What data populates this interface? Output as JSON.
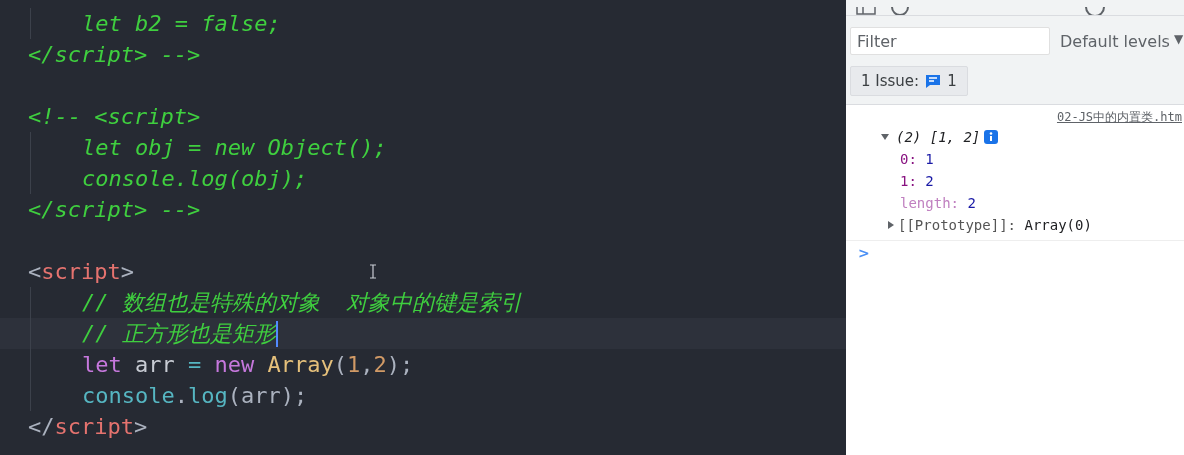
{
  "editor": {
    "lines": [
      {
        "kind": "code",
        "indented": true,
        "tokens": [
          {
            "kind": "comment",
            "text": "let b2 = false;"
          }
        ]
      },
      {
        "kind": "code",
        "indented": false,
        "tokens": [
          {
            "kind": "comment",
            "text": "</script> -->"
          }
        ]
      },
      {
        "kind": "blank"
      },
      {
        "kind": "code",
        "indented": false,
        "tokens": [
          {
            "kind": "comment",
            "text": "<!-- <script>"
          }
        ]
      },
      {
        "kind": "code",
        "indented": true,
        "tokens": [
          {
            "kind": "comment",
            "text": "let obj = new Object();"
          }
        ]
      },
      {
        "kind": "code",
        "indented": true,
        "tokens": [
          {
            "kind": "comment",
            "text": "console.log(obj);"
          }
        ]
      },
      {
        "kind": "code",
        "indented": false,
        "tokens": [
          {
            "kind": "comment",
            "text": "</script> -->"
          }
        ]
      },
      {
        "kind": "blank"
      },
      {
        "kind": "code",
        "indented": false,
        "tokens": [
          {
            "kind": "punct",
            "text": "<"
          },
          {
            "kind": "tag",
            "text": "script"
          },
          {
            "kind": "punct",
            "text": ">"
          }
        ]
      },
      {
        "kind": "code",
        "indented": true,
        "tokens": [
          {
            "kind": "comment",
            "text": "// 数组也是特殊的对象  对象中的键是索引"
          }
        ]
      },
      {
        "kind": "code",
        "indented": true,
        "current": true,
        "tokens": [
          {
            "kind": "comment",
            "text": "// 正方形也是矩形"
          }
        ]
      },
      {
        "kind": "code",
        "indented": true,
        "tokens": [
          {
            "kind": "keyword",
            "text": "let"
          },
          {
            "kind": "ident",
            "text": " arr "
          },
          {
            "kind": "operator",
            "text": "="
          },
          {
            "kind": "keyword",
            "text": " new"
          },
          {
            "kind": "class",
            "text": " Array"
          },
          {
            "kind": "punct",
            "text": "("
          },
          {
            "kind": "number",
            "text": "1"
          },
          {
            "kind": "punct",
            "text": ","
          },
          {
            "kind": "number",
            "text": "2"
          },
          {
            "kind": "punct",
            "text": ");"
          }
        ]
      },
      {
        "kind": "code",
        "indented": true,
        "tokens": [
          {
            "kind": "func",
            "text": "console"
          },
          {
            "kind": "punct",
            "text": "."
          },
          {
            "kind": "func",
            "text": "log"
          },
          {
            "kind": "punct",
            "text": "(arr);"
          }
        ]
      },
      {
        "kind": "code",
        "indented": false,
        "tokens": [
          {
            "kind": "punct",
            "text": "</"
          },
          {
            "kind": "tag",
            "text": "script"
          },
          {
            "kind": "punct",
            "text": ">"
          }
        ]
      }
    ]
  },
  "devtools": {
    "filter": {
      "placeholder": "Filter"
    },
    "levels": "Default levels",
    "levels_caret": "▼",
    "issues": {
      "label": "1 Issue:",
      "count": "1"
    },
    "console": {
      "source": "02-JS中的内置类.htm",
      "entry": {
        "summary": "(2) [1, 2]",
        "expanded": true,
        "properties": [
          {
            "kind": "index",
            "key": "0:",
            "value": "1"
          },
          {
            "kind": "index",
            "key": "1:",
            "value": "2"
          },
          {
            "kind": "meta",
            "key": "length:",
            "value": "2"
          },
          {
            "kind": "proto",
            "key": "[[Prototype]]:",
            "value": "Array(0)",
            "expanded": false
          }
        ]
      },
      "prompt": ">"
    }
  }
}
